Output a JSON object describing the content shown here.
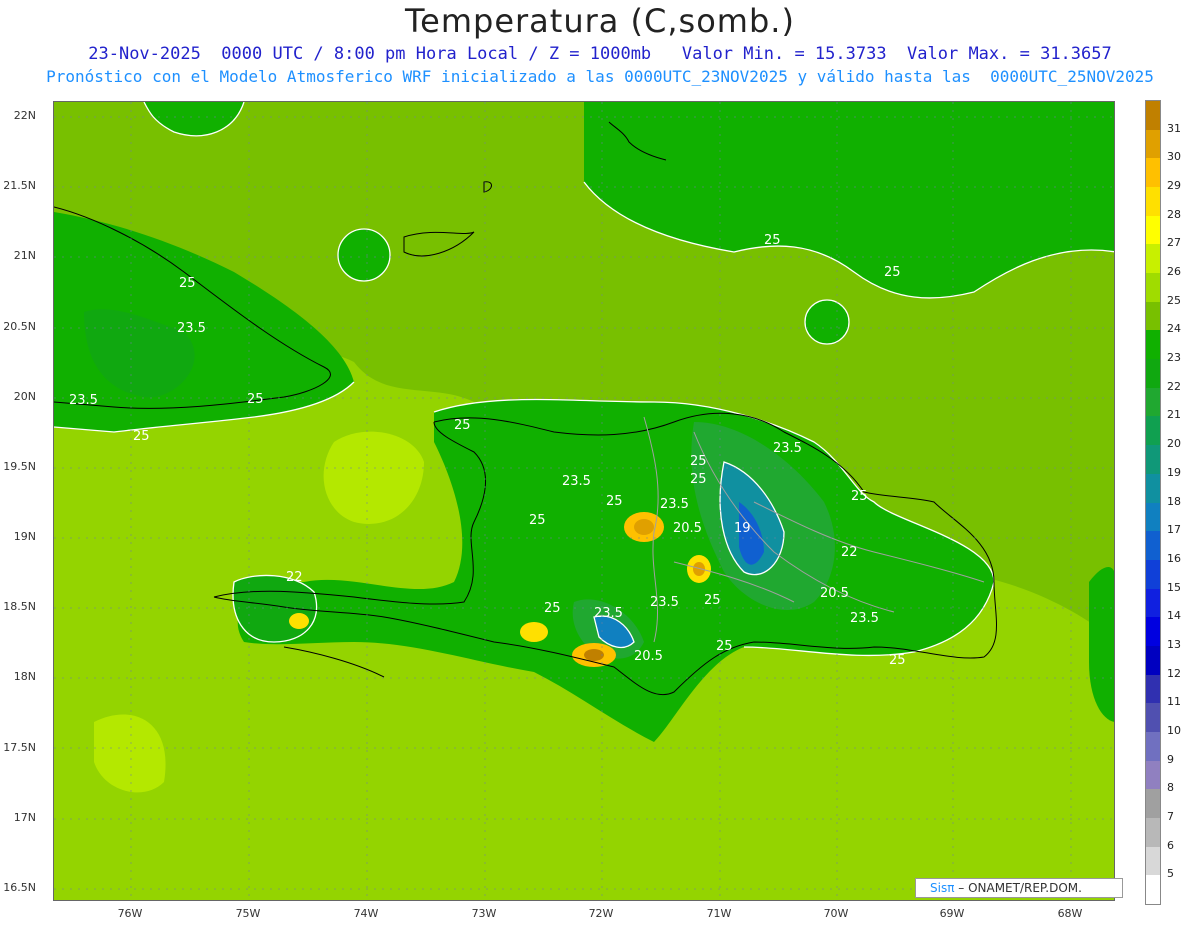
{
  "header": {
    "title": "Temperatura (C,somb.)",
    "line1": "23-Nov-2025  0000 UTC / 8:00 pm Hora Local / Z = 1000mb   Valor Min. = 15.3733  Valor Max. = 31.3657",
    "line2": "Pronóstico con el Modelo Atmosferico WRF inicializado a las 0000UTC_23NOV2025 y válido hasta las  0000UTC_25NOV2025"
  },
  "axes": {
    "lat_labels": [
      "22N",
      "21.5N",
      "21N",
      "20.5N",
      "20N",
      "19.5N",
      "19N",
      "18.5N",
      "18N",
      "17.5N",
      "17N",
      "16.5N"
    ],
    "lon_labels": [
      "76W",
      "75W",
      "74W",
      "73W",
      "72W",
      "71W",
      "70W",
      "69W",
      "68W"
    ]
  },
  "contour_labels": [
    "25",
    "25",
    "25",
    "23.5",
    "23.5",
    "25",
    "25",
    "25",
    "23.5",
    "25",
    "25",
    "23.5",
    "25",
    "25",
    "23.5",
    "20.5",
    "19",
    "22",
    "25",
    "22",
    "20.5",
    "23.5",
    "25",
    "25",
    "23.5",
    "25",
    "23.5",
    "20.5",
    "25"
  ],
  "colorbar": {
    "labels": [
      "31",
      "30",
      "29",
      "28",
      "27",
      "26",
      "25",
      "24",
      "23",
      "22",
      "21",
      "20",
      "19",
      "18",
      "17",
      "16",
      "15",
      "14",
      "13",
      "12",
      "11",
      "10",
      "9",
      "8",
      "7",
      "6",
      "5"
    ],
    "colors": [
      "#c08000",
      "#e0a000",
      "#ffc000",
      "#ffe000",
      "#ffff00",
      "#c8f000",
      "#a0dc00",
      "#78c000",
      "#10b000",
      "#10a810",
      "#20a830",
      "#10a050",
      "#109878",
      "#1090a0",
      "#1080c0",
      "#1060d0",
      "#1040d8",
      "#1020e0",
      "#0000e0",
      "#0000c0",
      "#3030b0",
      "#5050b0",
      "#7070c0",
      "#9080c0",
      "#a0a0a0",
      "#b8b8b8",
      "#d8d8d8",
      "#ffffff"
    ]
  },
  "credit": {
    "brand": "Sisπ",
    "text": " – ONAMET/REP.DOM."
  }
}
